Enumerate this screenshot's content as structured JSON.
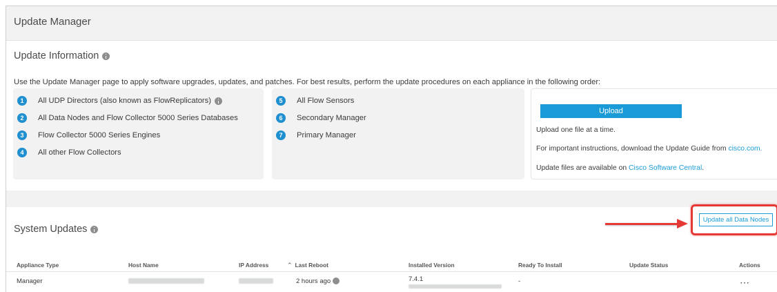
{
  "header": {
    "title": "Update Manager"
  },
  "update_info": {
    "title": "Update Information",
    "intro": "Use the Update Manager page to apply software upgrades, updates, and patches. For best results, perform the update procedures on each appliance in the following order:",
    "steps_left": [
      {
        "num": "1",
        "label": "All UDP Directors (also known as FlowReplicators)"
      },
      {
        "num": "2",
        "label": "All Data Nodes and Flow Collector 5000 Series Databases"
      },
      {
        "num": "3",
        "label": "Flow Collector 5000 Series Engines"
      },
      {
        "num": "4",
        "label": "All other Flow Collectors"
      }
    ],
    "steps_mid": [
      {
        "num": "5",
        "label": "All Flow Sensors"
      },
      {
        "num": "6",
        "label": "Secondary Manager"
      },
      {
        "num": "7",
        "label": "Primary Manager"
      }
    ]
  },
  "upload": {
    "button_label": "Upload",
    "line1": "Upload one file at a time.",
    "line2_prefix": "For important instructions, download the Update Guide from ",
    "line2_link": "cisco.com.",
    "line3_prefix": "Update files are available on ",
    "line3_link": "Cisco Software Central",
    "line3_suffix": "."
  },
  "system_updates": {
    "title": "System Updates",
    "update_all_label": "Update all Data Nodes",
    "columns": {
      "appliance_type": "Appliance Type",
      "host_name": "Host Name",
      "ip_address": "IP Address",
      "last_reboot": "Last Reboot",
      "installed_version": "Installed Version",
      "ready_to_install": "Ready To Install",
      "update_status": "Update Status",
      "actions": "Actions"
    },
    "rows": [
      {
        "appliance_type": "Manager",
        "last_reboot": "2 hours ago",
        "installed_version": "7.4.1",
        "ready_to_install": "-",
        "actions": "⋯"
      }
    ]
  },
  "colors": {
    "accent": "#1a9bd7",
    "step_badge": "#1f8fd0",
    "highlight": "#e53935"
  }
}
